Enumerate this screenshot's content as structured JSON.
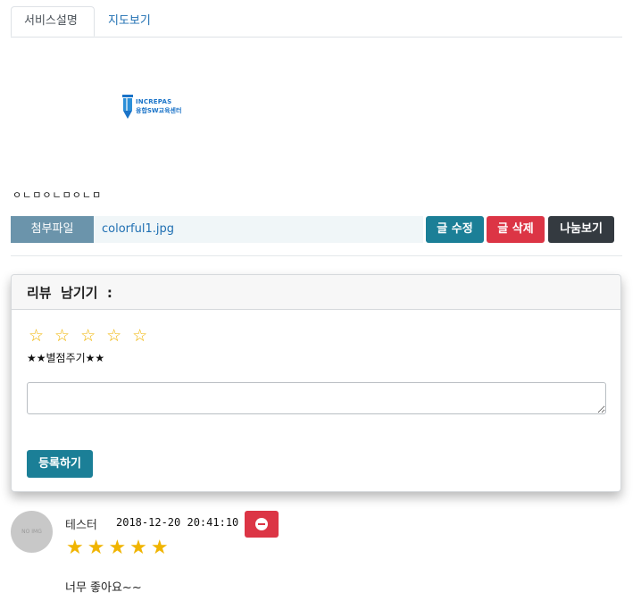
{
  "tabs": [
    {
      "label": "서비스설명"
    },
    {
      "label": "지도보기"
    }
  ],
  "logo": {
    "line1": "INCREPAS",
    "line2": "융합SW교육센터"
  },
  "content_text": "ㅇㄴㅁㅇㄴㅁㅇㄴㅁ",
  "attachment": {
    "label": "첨부파일",
    "filename": "colorful1.jpg"
  },
  "actions": {
    "edit": "글 수정",
    "delete": "글 삭제",
    "share": "나눔보기"
  },
  "review_form": {
    "title": "리뷰  남기기  :",
    "empty_stars": "☆☆☆☆☆",
    "star_hint": "★★별점주기★★",
    "input_value": "",
    "submit": "등록하기"
  },
  "reviews": [
    {
      "avatar_text": "NO IMG",
      "author": "테스터",
      "date": "2018-12-20 20:41:10",
      "stars": "★★★★★",
      "rating": 5,
      "text": "너무 좋아요~~"
    }
  ],
  "colors": {
    "primary": "#1b7f97",
    "danger": "#dc3545",
    "dark": "#343a40",
    "star": "#f0b400",
    "link": "#1f6fb2"
  }
}
